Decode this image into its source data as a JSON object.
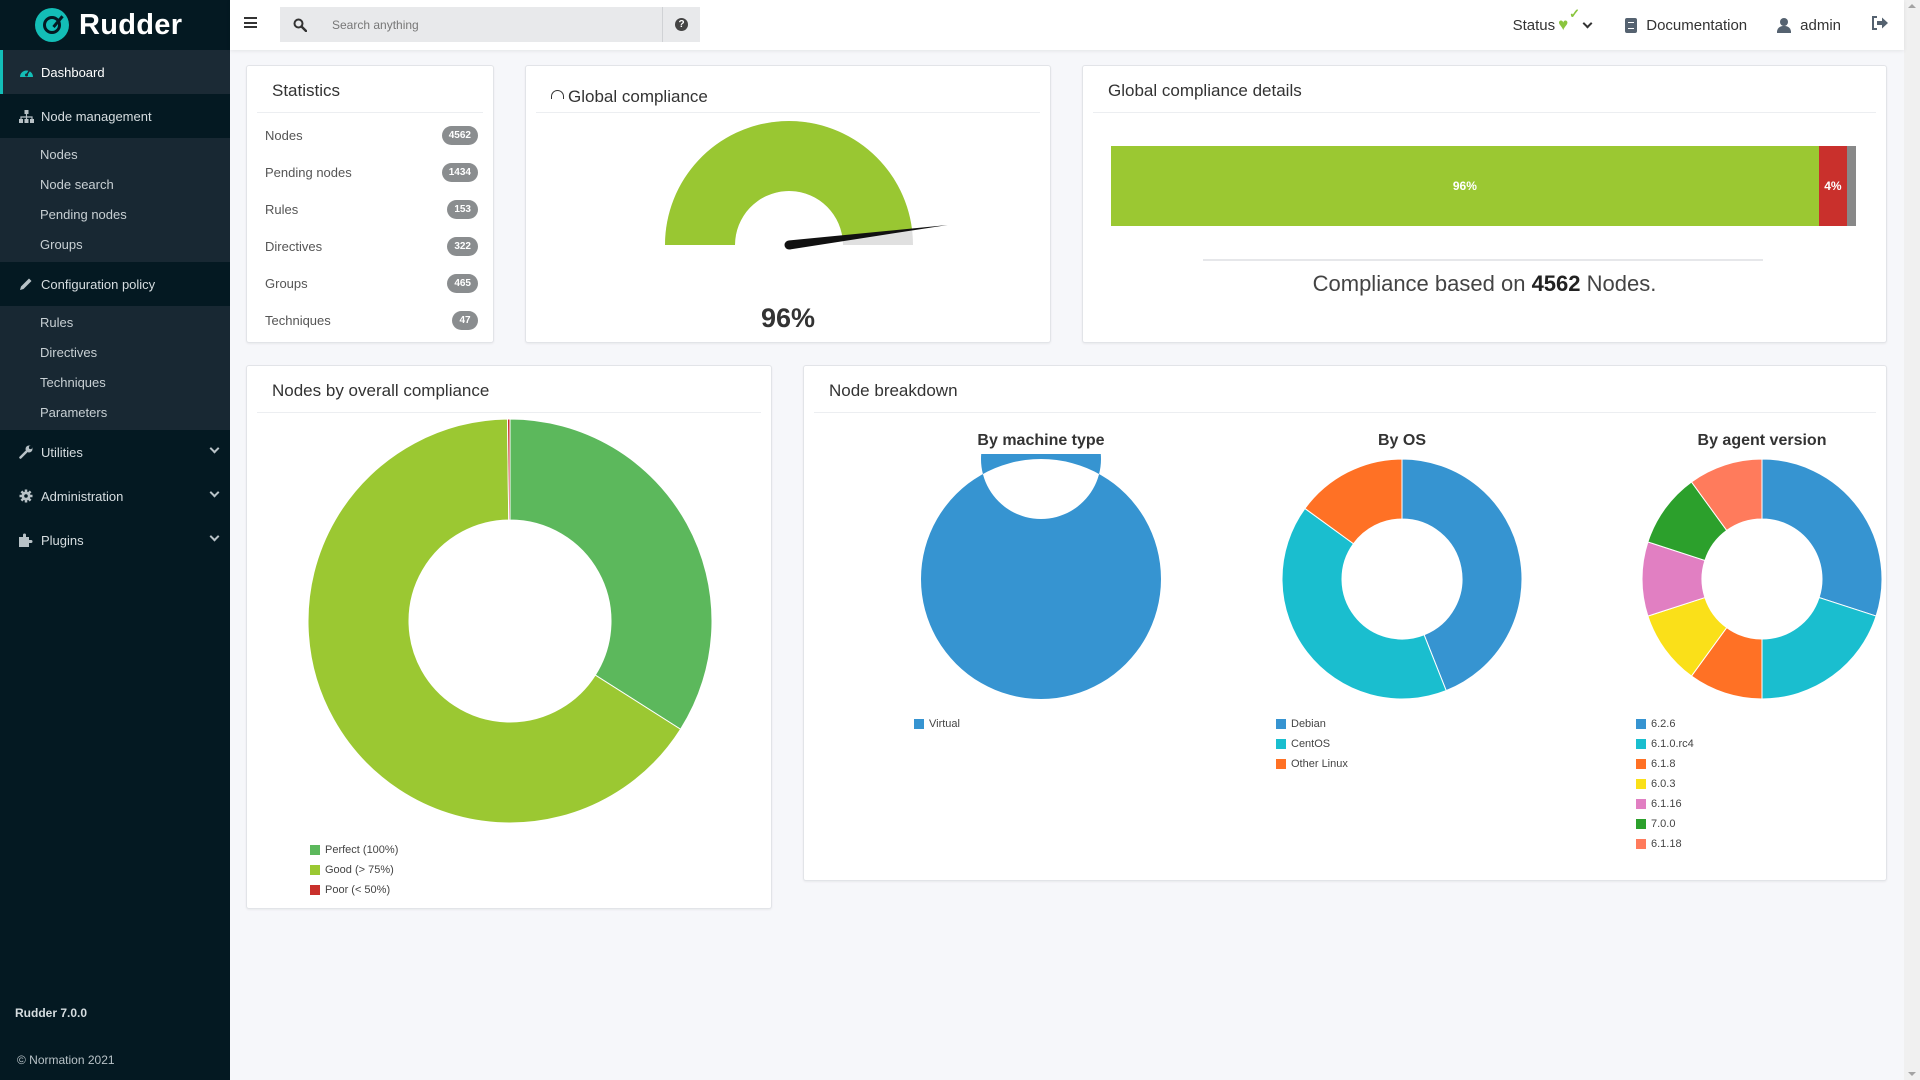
{
  "app": {
    "brand": "Rudder",
    "version_label": "Rudder 7.0.0",
    "copyright": "© Normation 2021"
  },
  "topbar": {
    "search_placeholder": "Search anything",
    "search_value": "",
    "status_label": "Status",
    "documentation_label": "Documentation",
    "user_label": "admin",
    "icons": {
      "menu": "hamburger-icon",
      "search": "search-icon",
      "help": "question-circle-icon",
      "status": "heartbeat-check-icon",
      "documentation": "book-icon",
      "user": "user-icon",
      "logout": "sign-out-icon"
    },
    "colors": {
      "status_ok": "#8ac53e"
    }
  },
  "sidebar": {
    "accent": "#13beb7",
    "items": [
      {
        "label": "Dashboard",
        "icon": "tachometer-icon",
        "active": true
      },
      {
        "label": "Node management",
        "icon": "sitemap-icon",
        "children": [
          "Nodes",
          "Node search",
          "Pending nodes",
          "Groups"
        ]
      },
      {
        "label": "Configuration policy",
        "icon": "pencil-icon",
        "children": [
          "Rules",
          "Directives",
          "Techniques",
          "Parameters"
        ]
      },
      {
        "label": "Utilities",
        "icon": "wrench-icon",
        "collapsible": true
      },
      {
        "label": "Administration",
        "icon": "gear-icon",
        "collapsible": true
      },
      {
        "label": "Plugins",
        "icon": "puzzle-icon",
        "collapsible": true
      }
    ]
  },
  "statistics": {
    "title": "Statistics",
    "rows": [
      {
        "label": "Nodes",
        "value": "4562"
      },
      {
        "label": "Pending nodes",
        "value": "1434"
      },
      {
        "label": "Rules",
        "value": "153"
      },
      {
        "label": "Directives",
        "value": "322"
      },
      {
        "label": "Groups",
        "value": "465"
      },
      {
        "label": "Techniques",
        "value": "47"
      }
    ]
  },
  "global_compliance": {
    "title": "Global compliance",
    "value_label": "96%",
    "value": 96,
    "color": "#99c732",
    "track_color": "#e0e0e0"
  },
  "compliance_details": {
    "title": "Global compliance details",
    "segments": [
      {
        "label": "96%",
        "value": 95.0,
        "color": "#9bc832"
      },
      {
        "label": "4%",
        "value": 3.8,
        "color": "#c9302c"
      },
      {
        "label": "",
        "value": 1.2,
        "color": "#888888"
      }
    ],
    "caption_prefix": "Compliance based on",
    "caption_count": "4562",
    "caption_suffix": "Nodes."
  },
  "chart_data": [
    {
      "type": "pie",
      "title": "Nodes by overall compliance",
      "donut": true,
      "legend": "bottom-left",
      "categories": [
        "Perfect (100%)",
        "Good (> 75%)",
        "Poor (< 50%)"
      ],
      "values": [
        34,
        65.8,
        0.2
      ],
      "colors": [
        "#5cb85c",
        "#9bc832",
        "#c9302c"
      ]
    },
    {
      "type": "pie",
      "title": "By machine type",
      "donut": true,
      "legend": "bottom-left",
      "categories": [
        "Virtual"
      ],
      "values": [
        100
      ],
      "colors": [
        "#3694d1"
      ]
    },
    {
      "type": "pie",
      "title": "By OS",
      "donut": true,
      "legend": "bottom-left",
      "categories": [
        "Debian",
        "CentOS",
        "Other Linux"
      ],
      "values": [
        44,
        41,
        15
      ],
      "colors": [
        "#3694d1",
        "#1abecf",
        "#ff7125"
      ]
    },
    {
      "type": "pie",
      "title": "By agent version",
      "donut": true,
      "legend": "bottom-left",
      "categories": [
        "6.2.6",
        "6.1.0.rc4",
        "6.1.8",
        "6.0.3",
        "6.1.16",
        "7.0.0",
        "6.1.18"
      ],
      "values": [
        30,
        20,
        10,
        10,
        10,
        10,
        10
      ],
      "colors": [
        "#3694d1",
        "#1abecf",
        "#ff7125",
        "#fae019",
        "#e17fc2",
        "#2ca02c",
        "#ff7b5c"
      ]
    }
  ],
  "node_breakdown": {
    "title": "Node breakdown"
  }
}
